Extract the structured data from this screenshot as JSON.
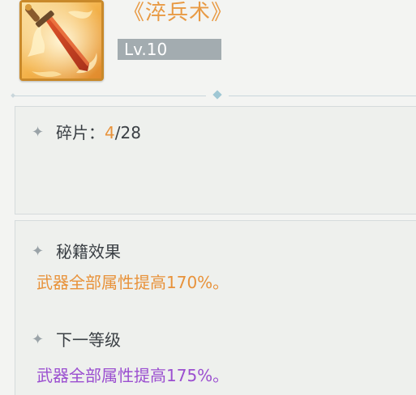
{
  "item": {
    "icon": "flaming-sword-icon",
    "title": "《淬兵术》",
    "level": "Lv.10"
  },
  "fragments": {
    "label": "碎片：",
    "current": "4",
    "separator": "/",
    "total": "28"
  },
  "effect": {
    "heading": "秘籍效果",
    "text": "武器全部属性提高170%。"
  },
  "next_level": {
    "heading": "下一等级",
    "text": "武器全部属性提高175%。"
  },
  "colors": {
    "title": "#e89a44",
    "effect_text": "#e8923a",
    "next_level_text": "#9b4fd0",
    "level_badge_bg": "#a3acb0"
  }
}
